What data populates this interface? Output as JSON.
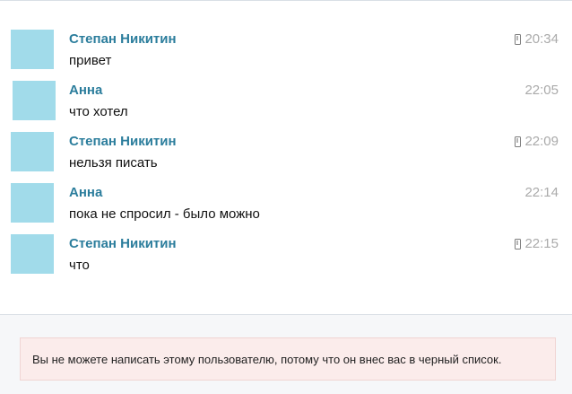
{
  "messages": [
    {
      "author": "Степан Никитин",
      "text": "привет",
      "time": "20:34",
      "mobile": true
    },
    {
      "author": "Анна",
      "text": "что хотел",
      "time": "22:05",
      "mobile": false
    },
    {
      "author": "Степан Никитин",
      "text": "нельзя писать",
      "time": "22:09",
      "mobile": true
    },
    {
      "author": "Анна",
      "text": "пока не спросил - было можно",
      "time": "22:14",
      "mobile": false
    },
    {
      "author": "Степан Никитин",
      "text": "что",
      "time": "22:15",
      "mobile": true
    }
  ],
  "notice": {
    "text": "Вы не можете написать этому пользователю, потому что он внес вас в черный список."
  },
  "colors": {
    "author": "#2b7d9c",
    "avatar_placeholder": "#a1dbea",
    "notice_background": "#fbeceb",
    "time": "#aaaaaa"
  },
  "icons": {
    "mobile": "mobile-phone-icon"
  }
}
